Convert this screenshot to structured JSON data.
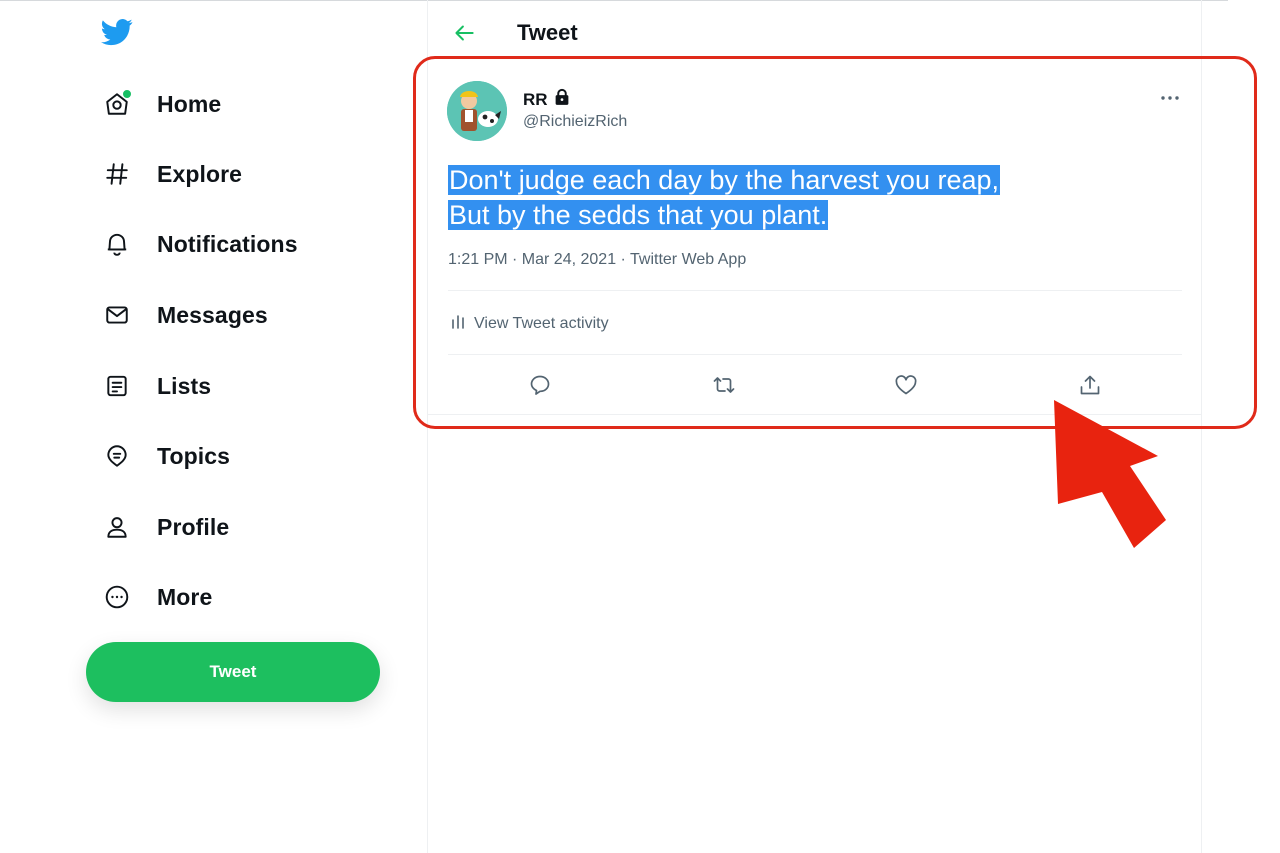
{
  "sidebar": {
    "logo_icon": "twitter-bird-icon",
    "items": [
      {
        "label": "Home",
        "icon": "home-icon",
        "notification_dot": true
      },
      {
        "label": "Explore",
        "icon": "hashtag-icon"
      },
      {
        "label": "Notifications",
        "icon": "bell-icon"
      },
      {
        "label": "Messages",
        "icon": "envelope-icon"
      },
      {
        "label": "Lists",
        "icon": "list-icon"
      },
      {
        "label": "Topics",
        "icon": "topics-icon"
      },
      {
        "label": "Profile",
        "icon": "person-icon"
      },
      {
        "label": "More",
        "icon": "more-circle-icon"
      }
    ],
    "tweet_button_label": "Tweet"
  },
  "header": {
    "title": "Tweet",
    "back_icon": "back-arrow-icon"
  },
  "tweet": {
    "author_name": "RR",
    "locked_icon": "lock-icon",
    "handle": "@RichieizRich",
    "text_lines": [
      "Don't judge each day by the harvest you reap,",
      "But by the sedds that you plant."
    ],
    "meta": "1:21 PM · Mar 24, 2021 · Twitter Web App",
    "activity_label": "View Tweet activity",
    "actions": [
      "reply-icon",
      "retweet-icon",
      "like-icon",
      "share-icon"
    ]
  },
  "colors": {
    "accent": "#1dbf5f",
    "selection": "#3390f0",
    "annotation": "#e02a1a"
  }
}
